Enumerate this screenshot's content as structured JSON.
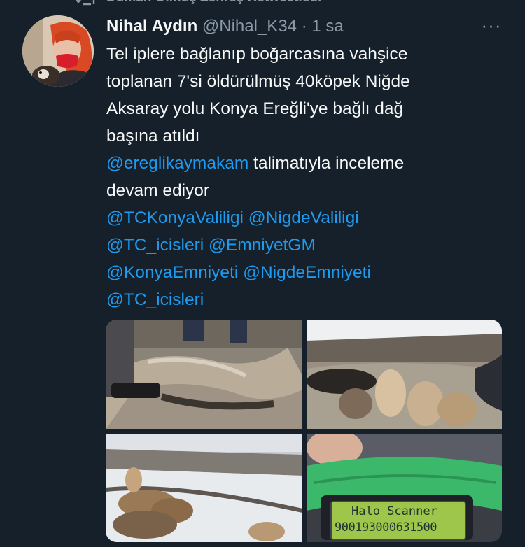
{
  "retweet": {
    "icon": "retweet-icon",
    "text": "Duman Olmuş Zehreş Retweetledi"
  },
  "tweet": {
    "author_name": "Nihal Aydın",
    "author_handle": "@Nihal_K34",
    "separator": "·",
    "time": "1 sa",
    "more_icon": "more-horizontal-icon",
    "more_glyph": "···",
    "lines": [
      {
        "parts": [
          {
            "text": "Tel iplere bağlanıp boğarcasına vahşice",
            "mention": false
          }
        ]
      },
      {
        "parts": [
          {
            "text": "toplanan 7'si öldürülmüş 40köpek Niğde",
            "mention": false
          }
        ]
      },
      {
        "parts": [
          {
            "text": "Aksaray yolu Konya Ereğli'ye bağlı dağ",
            "mention": false
          }
        ]
      },
      {
        "parts": [
          {
            "text": "başına atıldı",
            "mention": false
          }
        ]
      },
      {
        "parts": [
          {
            "text": "@ereglikaymakam",
            "mention": true
          },
          {
            "text": " talimatıyla inceleme",
            "mention": false
          }
        ]
      },
      {
        "parts": [
          {
            "text": "devam ediyor",
            "mention": false
          }
        ]
      },
      {
        "parts": [
          {
            "text": "@TCKonyaValiligi @NigdeValiligi",
            "mention": true
          }
        ]
      },
      {
        "parts": [
          {
            "text": "@TC_icisleri @EmniyetGM",
            "mention": true
          }
        ]
      },
      {
        "parts": [
          {
            "text": "@KonyaEmniyeti @NigdeEmniyeti",
            "mention": true
          }
        ]
      },
      {
        "parts": [
          {
            "text": "@TC_icisleri",
            "mention": true
          }
        ]
      }
    ],
    "media": {
      "scanner_line1": "Halo Scanner",
      "scanner_line2": "900193000631500"
    }
  },
  "colors": {
    "background": "#15202b",
    "mention": "#1d9bf0",
    "secondary_text": "#8b98a5",
    "primary_text": "#f7f9f9"
  }
}
